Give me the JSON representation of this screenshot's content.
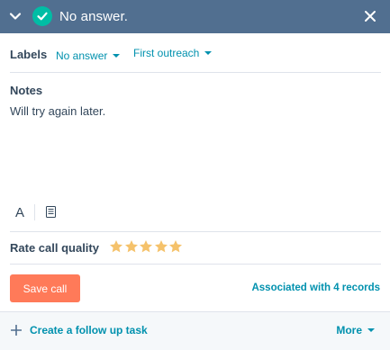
{
  "header": {
    "title": "No answer.",
    "collapse_icon": "chevron-down-icon",
    "status_icon": "check-circle-icon",
    "close_icon": "close-icon",
    "bg_color": "#516f90",
    "status_color": "#00bda5"
  },
  "labels": {
    "title": "Labels",
    "outcome_value": "No answer",
    "type_value": "First outreach"
  },
  "notes": {
    "title": "Notes",
    "text": "Will try again later."
  },
  "toolbar": {
    "font_label": "A",
    "font_icon": "text-format-icon",
    "snippet_icon": "snippet-icon"
  },
  "rating": {
    "title": "Rate call quality",
    "value": 5,
    "max": 5,
    "star_color": "#f5c26b"
  },
  "actions": {
    "save_label": "Save call",
    "save_color": "#ff7a59",
    "associations_label": "Associated with 4 records"
  },
  "footer": {
    "follow_up_label": "Create a follow up task",
    "follow_up_icon": "plus-icon",
    "more_label": "More"
  },
  "colors": {
    "link": "#0091ae",
    "text": "#33475b",
    "divider": "#dfe3eb"
  }
}
